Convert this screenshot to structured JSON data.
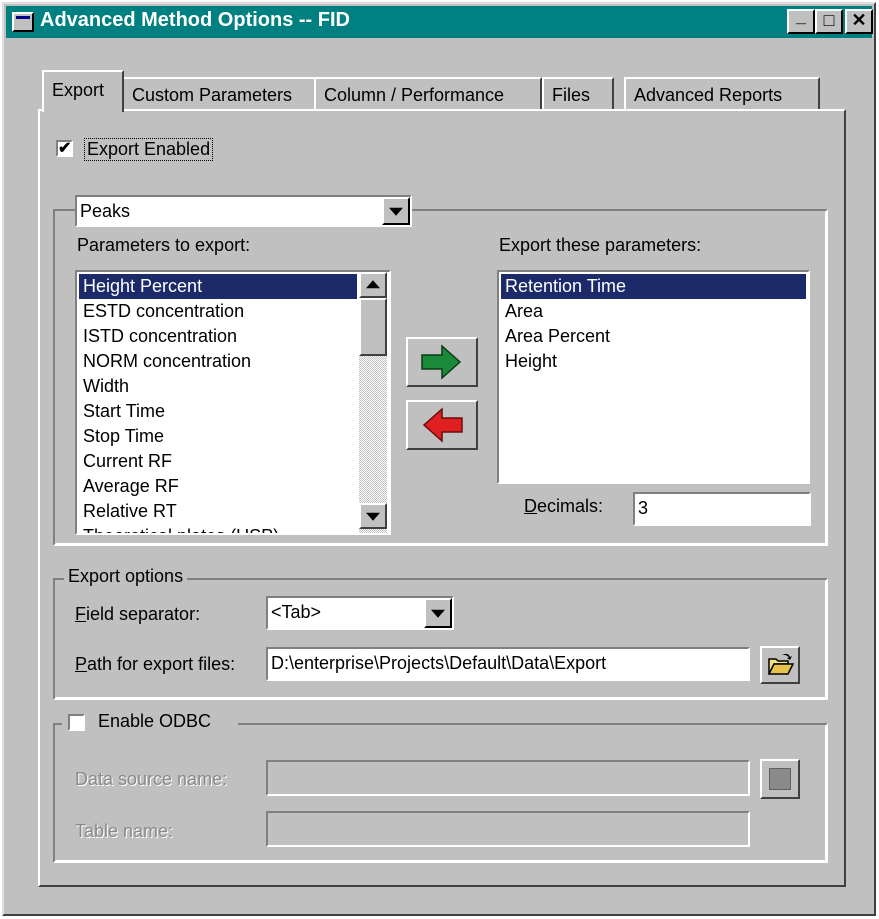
{
  "window": {
    "title": "Advanced Method Options -- FID",
    "controls": {
      "minimize": "_",
      "maximize": "□",
      "close": "✕"
    }
  },
  "tabs": [
    {
      "label": "Export",
      "active": true
    },
    {
      "label": "Custom Parameters",
      "active": false
    },
    {
      "label": "Column / Performance",
      "active": false
    },
    {
      "label": "Files",
      "active": false
    },
    {
      "label": "Advanced Reports",
      "active": false
    }
  ],
  "export_enabled": {
    "label": "Export Enabled",
    "checked": true,
    "check_glyph": "✔"
  },
  "peaks_group": {
    "selector_value": "Peaks",
    "parameters_label": "Parameters to export:",
    "parameters": [
      "Height Percent",
      "ESTD concentration",
      "ISTD concentration",
      "NORM concentration",
      "Width",
      "Start Time",
      "Stop Time",
      "Current RF",
      "Average RF",
      "Relative RT",
      "Theoretical plates (USP)"
    ],
    "parameters_selected": "Height Percent",
    "export_label": "Export these parameters:",
    "exported": [
      "Retention Time",
      "Area",
      "Area Percent",
      "Height"
    ],
    "exported_selected": "Retention Time",
    "decimals_label": "Decimals:",
    "decimals_value": "3",
    "add_icon": "right-arrow",
    "remove_icon": "left-arrow",
    "add_color": "#1a8a3a",
    "remove_color": "#e02020"
  },
  "export_options": {
    "legend": "Export options",
    "separator_label": "Field separator:",
    "separator_value": "<Tab>",
    "path_label": "Path for export files:",
    "path_value": "D:\\enterprise\\Projects\\Default\\Data\\Export",
    "browse_icon": "open-folder"
  },
  "odbc": {
    "legend": "Enable ODBC",
    "checked": false,
    "dsn_label": "Data source name:",
    "dsn_value": "",
    "table_label": "Table name:",
    "table_value": ""
  },
  "colors": {
    "title_bar": "#008080",
    "selection": "#1c2a6a",
    "face": "#c0c0c0"
  }
}
